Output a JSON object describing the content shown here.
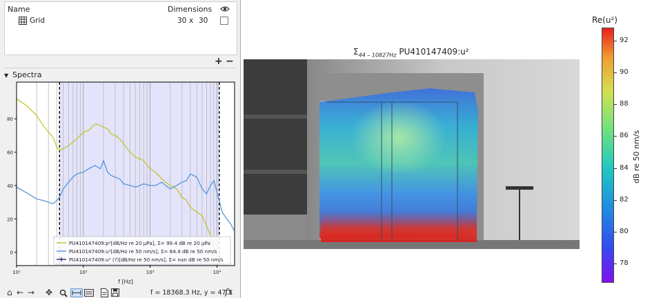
{
  "layers_table": {
    "col_name": "Name",
    "col_dimensions": "Dimensions",
    "visibility_icon": "eye-icon",
    "row": {
      "name": "Grid",
      "icon": "grid-icon",
      "dim_x": "30",
      "dim_sep": "x",
      "dim_y": "30",
      "visible": false
    }
  },
  "table_buttons": {
    "add": "+",
    "remove": "−"
  },
  "spectra_panel": {
    "title": "Spectra",
    "expanded": true
  },
  "spectra_chart": {
    "chart_data": {
      "type": "line",
      "xscale": "log",
      "xlim": [
        10,
        18368
      ],
      "ylim": [
        -8,
        102
      ],
      "xlabel": "f [Hz]",
      "xticks": [
        "10¹",
        "10²",
        "10³",
        "10⁴"
      ],
      "yticks": [
        "0",
        "20",
        "40",
        "60",
        "80"
      ],
      "highlight_band_hz": [
        44,
        10827
      ],
      "series": [
        {
          "name": "PU410147409:p²[dB/Hz re 20 µPa], Σ= 99.4 dB re 20 µPa",
          "color": "#c2c21e",
          "x": [
            10,
            14,
            20,
            25,
            30,
            35,
            40,
            44,
            50,
            60,
            70,
            80,
            100,
            120,
            150,
            180,
            200,
            230,
            260,
            300,
            350,
            400,
            500,
            600,
            700,
            800,
            1000,
            1200,
            1500,
            1700,
            2000,
            2500,
            3000,
            3500,
            4000,
            5000,
            6000,
            7000,
            8000,
            9000,
            10000
          ],
          "y": [
            92,
            88,
            82,
            76,
            72,
            69,
            63,
            61,
            62,
            64,
            66,
            68,
            72,
            73,
            77,
            76,
            75,
            74,
            71,
            70,
            68,
            65,
            60,
            57,
            56,
            55,
            50,
            48,
            44,
            42,
            40,
            38,
            33,
            31,
            27,
            24,
            22,
            16,
            10,
            4,
            -3
          ]
        },
        {
          "name": "PU410147409:u²[dB/Hz re 50 nm/s], Σ= 84.4 dB re 50 nm/s",
          "color": "#4a90d9",
          "x": [
            10,
            15,
            20,
            25,
            30,
            35,
            40,
            44,
            50,
            60,
            70,
            80,
            100,
            120,
            150,
            180,
            200,
            230,
            260,
            300,
            350,
            400,
            500,
            600,
            700,
            800,
            1000,
            1200,
            1500,
            1700,
            2000,
            2500,
            3000,
            3500,
            4000,
            5000,
            6000,
            7000,
            8000,
            9000,
            10000,
            11000,
            12000,
            14000,
            16000,
            18000
          ],
          "y": [
            39,
            35,
            32,
            31,
            30,
            29,
            31,
            33,
            38,
            42,
            45,
            47,
            48,
            50,
            52,
            50,
            55,
            48,
            46,
            45,
            44,
            41,
            40,
            39,
            40,
            41,
            40,
            40,
            42,
            40,
            38,
            40,
            42,
            43,
            47,
            45,
            38,
            35,
            40,
            43,
            36,
            30,
            24,
            20,
            17,
            13
          ]
        },
        {
          "name": "PU410147409:u² (?)[dB/Hz re 50 nm/s], Σ= nan dB re 50 nm/s",
          "color": "#1f2a6b",
          "x": [],
          "y": []
        }
      ]
    }
  },
  "toolbar": {
    "home": "⌂",
    "back": "←",
    "forward": "→",
    "pan": "✥",
    "zoom": "🔍",
    "status": "f = 18368.3 Hz, y = 47.3",
    "fx": "fx"
  },
  "heatmap": {
    "title_prefix": "Σ",
    "title_sub": "44 – 10827Hz",
    "title_main": "PU410147409:u²"
  },
  "colorbar": {
    "title": "Re(u²)",
    "label": "dB re 50 nm/s",
    "ticks": [
      "92",
      "90",
      "88",
      "86",
      "84",
      "82",
      "80",
      "78"
    ],
    "min": 76.8,
    "max": 92.8
  }
}
